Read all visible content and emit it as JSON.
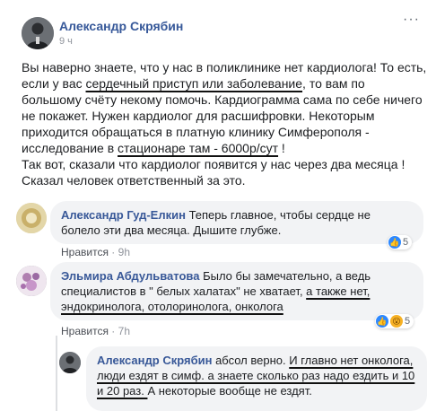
{
  "post": {
    "author": "Александр Скрябин",
    "time": "9 ч",
    "more_label": "···",
    "text": {
      "p1_a": "Вы наверно знаете, что у нас в поликлинике нет кардиолога! То есть, если у вас ",
      "p1_u1": "сердечный приступ или заболевание",
      "p1_b": ", то вам по большому счёту некому помочь. Кардиограмма сама по себе ничего не покажет. Нужен кардиолог для расшифровки. Некоторым приходится обращаться в платную клинику Симферополя - исследование в ",
      "p1_u2": "стационаре там - 6000р/сут",
      "p1_c": " !",
      "p2": "Так вот, сказали что кардиолог появится у нас через два месяца !",
      "p3": "Сказал человек ответственный за это."
    }
  },
  "comments": [
    {
      "author": "Александр Гуд-Елкин",
      "text": " Теперь главное, чтобы сердце не болело эти два месяца. Дышите глубже.",
      "like_label": "Нравится",
      "time": "9h",
      "reaction_count": "5",
      "reaction_icons": [
        "like-icon"
      ]
    },
    {
      "author": "Эльмира Абдульватова",
      "text_a": " Было бы замечательно, а ведь специалистов в \" белых халатах\" не хватает, ",
      "text_u": "а также нет, эндокринолога, отолоринолога, онколога",
      "like_label": "Нравится",
      "time": "7h",
      "reaction_count": "5",
      "reaction_icons": [
        "like-icon",
        "wow-icon"
      ]
    }
  ],
  "reply": {
    "author": "Александр Скрябин",
    "text_a": " абсол верно. ",
    "text_u1": "И главно нет онколога, люди ездят в симф. а знаете сколько раз надо ездить и 10 и 20 раз. ",
    "text_b": "А некоторые вообще не ездят."
  },
  "colors": {
    "link": "#365899",
    "bubble": "#f2f3f5",
    "meta": "#90949c",
    "like_blue": "#2d88ff"
  }
}
